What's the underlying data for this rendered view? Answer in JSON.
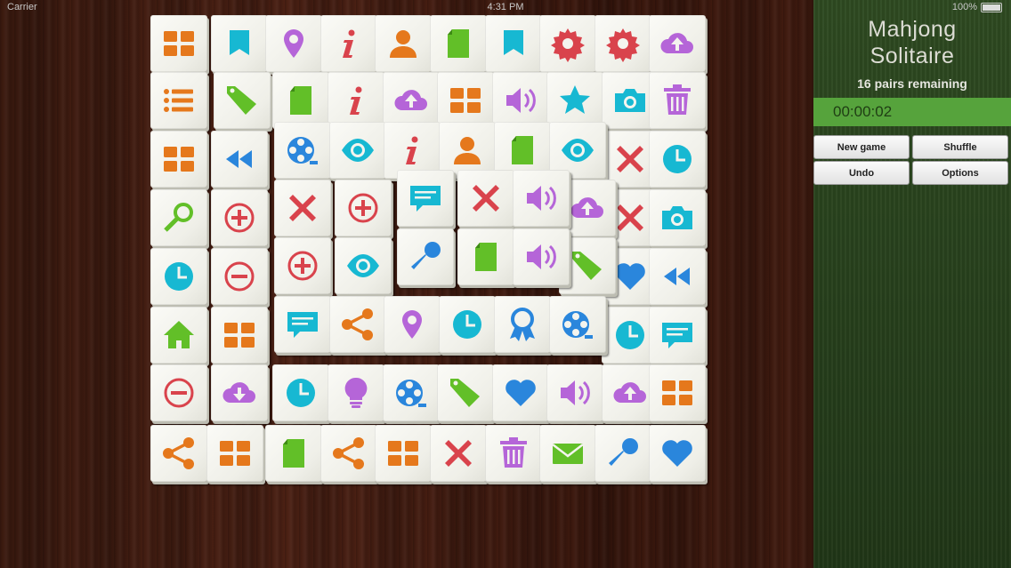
{
  "status_bar": {
    "carrier": "Carrier",
    "time": "4:31 PM",
    "battery": "100%"
  },
  "panel": {
    "title_line1": "Mahjong",
    "title_line2": "Solitaire",
    "pairs_remaining": "16 pairs remaining",
    "timer": "00:00:02",
    "new_game_label": "New game",
    "shuffle_label": "Shuffle",
    "undo_label": "Undo",
    "options_label": "Options"
  },
  "colors": {
    "orange": "#e5781c",
    "teal": "#17b8d2",
    "purple": "#b565d8",
    "red": "#d9434c",
    "green": "#62bf28",
    "blue": "#2a86dc",
    "timer_bar": "#56a33c"
  },
  "board": {
    "layers": [
      {
        "layer": 0,
        "rows": [
          [
            "grid-icon",
            "bookmark-icon",
            "map-pin-icon",
            "info-icon",
            "user-icon",
            "document-icon",
            "bookmark-icon",
            "gear-icon",
            "gear-icon",
            "cloud-upload-icon"
          ],
          [
            "list-icon",
            "tag-icon",
            "document-icon",
            "info-icon",
            "cloud-upload-icon",
            "grid-icon",
            "speaker-icon",
            "star-icon",
            "camera-icon",
            "trash-icon"
          ],
          [
            "grid-icon",
            "rewind-icon",
            "",
            "",
            "",
            "",
            "",
            "",
            "close-icon",
            "clock-icon"
          ],
          [
            "magnifier-icon",
            "plus-circle-icon",
            "",
            "",
            "",
            "",
            "",
            "",
            "close-icon",
            "camera-icon"
          ],
          [
            "clock-icon",
            "minus-circle-icon",
            "",
            "",
            "",
            "",
            "",
            "",
            "heart-icon",
            "rewind-icon"
          ],
          [
            "home-icon",
            "grid-icon",
            "",
            "",
            "",
            "",
            "",
            "",
            "clock-icon",
            "chat-icon"
          ],
          [
            "minus-circle-icon",
            "cloud-download-icon",
            "clock-icon",
            "lightbulb-icon",
            "film-reel-icon",
            "tag-icon",
            "heart-icon",
            "speaker-icon",
            "cloud-upload-icon",
            "grid-icon"
          ],
          [
            "share-icon",
            "grid-icon",
            "document-icon",
            "share-icon",
            "grid-icon",
            "close-icon",
            "trash-icon",
            "mail-icon",
            "microphone-icon",
            "heart-icon"
          ]
        ]
      },
      {
        "layer": 1,
        "rows": [
          [
            "film-reel-icon",
            "eye-icon",
            "info-icon",
            "user-icon",
            "document-icon",
            "eye-icon"
          ],
          [
            "close-icon",
            "plus-circle-icon",
            "",
            "",
            "cloud-upload-icon"
          ],
          [
            "plus-circle-icon",
            "eye-icon",
            "",
            "",
            "tag-icon"
          ],
          [
            "chat-icon",
            "share-icon",
            "map-pin-icon",
            "clock-icon",
            "ribbon-icon",
            "film-reel-icon"
          ]
        ]
      },
      {
        "layer": 2,
        "rows": [
          [
            "chat-icon",
            "close-icon",
            "speaker-icon"
          ],
          [
            "microphone-icon",
            "document-icon",
            "speaker-icon"
          ]
        ]
      }
    ]
  }
}
